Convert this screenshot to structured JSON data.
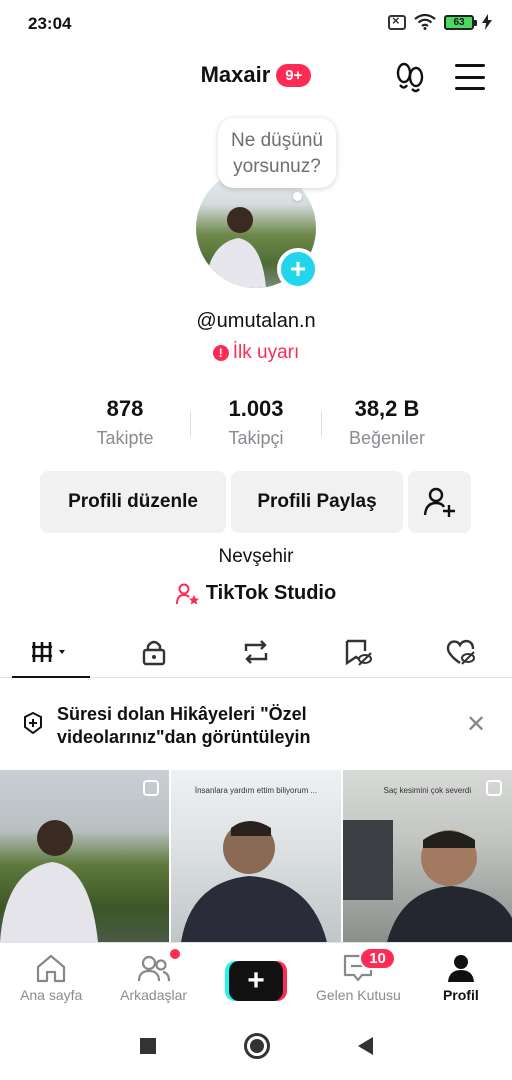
{
  "status_bar": {
    "time": "23:04",
    "battery_level": "63",
    "icons": [
      "sim-off-icon",
      "wifi-icon",
      "battery-icon",
      "charging-icon"
    ]
  },
  "header": {
    "username": "Maxair",
    "badge": "9+",
    "right_icons": [
      "footprint-icon",
      "menu-icon"
    ]
  },
  "profile": {
    "thought_bubble": "Ne düşünü yorsunuz?",
    "handle": "@umutalan.n",
    "warning": "İlk uyarı",
    "stats": [
      {
        "value": "878",
        "label": "Takipte"
      },
      {
        "value": "1.003",
        "label": "Takipçi"
      },
      {
        "value": "38,2 B",
        "label": "Beğeniler"
      }
    ],
    "edit_button": "Profili düzenle",
    "share_button": "Profili Paylaş",
    "location": "Nevşehir",
    "studio_link": "TikTok Studio"
  },
  "tabs": [
    {
      "icon": "grid-icon",
      "active": true
    },
    {
      "icon": "lock-icon",
      "active": false
    },
    {
      "icon": "repost-icon",
      "active": false
    },
    {
      "icon": "bookmark-hidden-icon",
      "active": false
    },
    {
      "icon": "heart-hidden-icon",
      "active": false
    }
  ],
  "story_banner": {
    "text": "Süresi dolan Hikâyeleri \"Özel videolarınız\"dan görüntüleyin"
  },
  "videos": [
    {
      "caption": ""
    },
    {
      "caption": "İnsanlara yardım ettim biliyorum ..."
    },
    {
      "caption": "Saç kesimini çok severdi"
    }
  ],
  "bottom_nav": {
    "home": "Ana sayfa",
    "friends": "Arkadaşlar",
    "create": "+",
    "inbox": "Gelen Kutusu",
    "inbox_badge": "10",
    "profile": "Profil"
  },
  "colors": {
    "accent": "#fe2c55",
    "cyan": "#20d5ec"
  }
}
